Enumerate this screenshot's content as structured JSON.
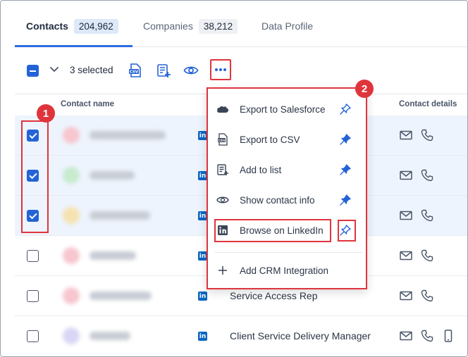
{
  "tabs": [
    {
      "label": "Contacts",
      "count": "204,962",
      "active": true
    },
    {
      "label": "Companies",
      "count": "38,212",
      "active": false
    },
    {
      "label": "Data Profile",
      "count": null,
      "active": false
    }
  ],
  "toolbar": {
    "selected_text": "3 selected",
    "icons": [
      "csv-export-icon",
      "add-to-list-icon",
      "eye-icon",
      "more-options-icon"
    ]
  },
  "table": {
    "headers": {
      "contact_name": "Contact name",
      "contact_details": "Contact details"
    },
    "rows": [
      {
        "checked": true,
        "avatar_color": "#f7c6ce",
        "title": ""
      },
      {
        "checked": true,
        "avatar_color": "#c6ebcf",
        "title": ""
      },
      {
        "checked": true,
        "avatar_color": "#f5e2b0",
        "title": ""
      },
      {
        "checked": false,
        "avatar_color": "#f7c6ce",
        "title": ""
      },
      {
        "checked": false,
        "avatar_color": "#f7c6ce",
        "title": "Service Access Rep"
      },
      {
        "checked": false,
        "avatar_color": "#d8d6f5",
        "title": "Client Service Delivery Manager"
      }
    ]
  },
  "menu": {
    "items": [
      {
        "label": "Export to Salesforce",
        "icon": "salesforce-icon",
        "pinned": false
      },
      {
        "label": "Export to CSV",
        "icon": "csv-icon",
        "pinned": true
      },
      {
        "label": "Add to list",
        "icon": "add-to-list-icon",
        "pinned": true
      },
      {
        "label": "Show contact info",
        "icon": "eye-icon",
        "pinned": true
      },
      {
        "label": "Browse on LinkedIn",
        "icon": "linkedin-icon",
        "pinned": false
      }
    ],
    "add_crm_label": "Add CRM Integration"
  },
  "annotations": {
    "badge_1": "1",
    "badge_2": "2"
  },
  "colors": {
    "accent": "#2463d6",
    "annotation_red": "#e0343c",
    "selected_row": "#eef4fd",
    "linkedin": "#0a66c2"
  }
}
